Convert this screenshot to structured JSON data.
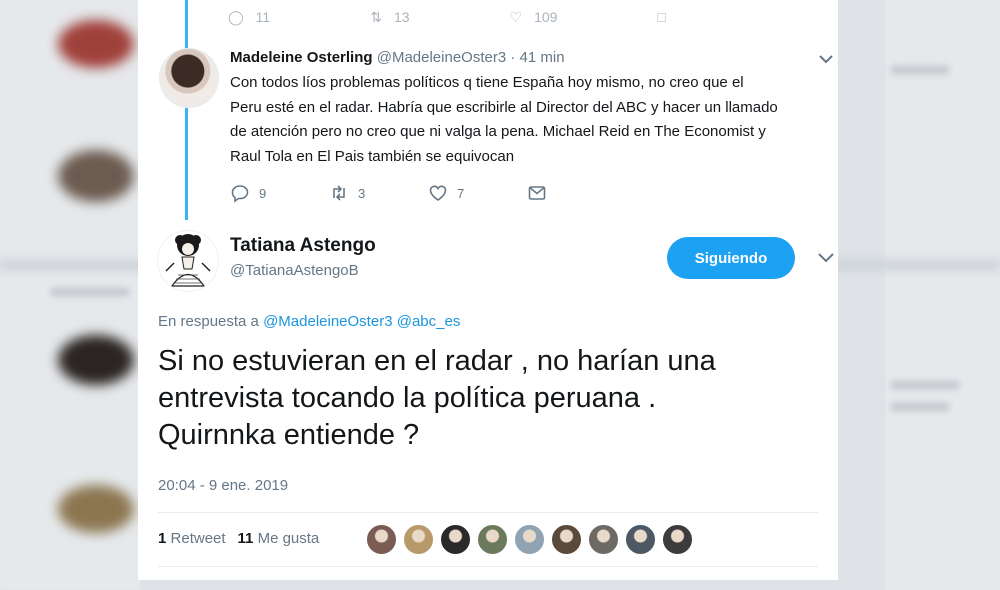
{
  "previous_tweet": {
    "replies": "11",
    "retweets": "13",
    "likes": "109"
  },
  "reply": {
    "name": "Madeleine Osterling",
    "handle": "@MadeleineOster3",
    "time": "· 41 min",
    "lines": [
      "Con todos líos problemas políticos q tiene España hoy mismo, no creo que el",
      "Peru esté en el radar. Habría que escribirle al Director del ABC y hacer un llamado",
      "de atención pero no creo que ni valga la pena. Michael Reid en The Economist y",
      "Raul Tola en El Pais también se equivocan"
    ],
    "replies": "9",
    "retweets": "3",
    "likes": "7"
  },
  "main": {
    "name": "Tatiana Astengo",
    "handle": "@TatianaAstengoB",
    "follow_label": "Siguiendo",
    "reply_prefix": "En respuesta a",
    "mentions": [
      "@MadeleineOster3",
      "@abc_es"
    ],
    "text_lines": [
      "Si no estuvieran en el radar , no harían una",
      "entrevista tocando la política peruana .",
      "Quirnnka entiende ?"
    ],
    "timestamp": "20:04 - 9 ene. 2019",
    "retweet_count": "1",
    "retweet_label": "Retweet",
    "like_count": "11",
    "like_label": "Me gusta"
  },
  "likers": [
    {
      "name": "liker-avatar",
      "color": "#7b5c52"
    },
    {
      "name": "liker-avatar",
      "color": "#b89a6a"
    },
    {
      "name": "liker-avatar",
      "color": "#2a2a2a"
    },
    {
      "name": "liker-avatar",
      "color": "#6b7a5c"
    },
    {
      "name": "liker-avatar",
      "color": "#8fa3b3"
    },
    {
      "name": "liker-avatar",
      "color": "#5a4a3c"
    },
    {
      "name": "liker-avatar",
      "color": "#6d6a66"
    },
    {
      "name": "liker-avatar",
      "color": "#4c5864"
    },
    {
      "name": "liker-avatar",
      "color": "#3c3c3c"
    }
  ],
  "colors": {
    "accent": "#1da1f2",
    "thread_line": "#39b5f5",
    "secondary_text": "#657786"
  }
}
